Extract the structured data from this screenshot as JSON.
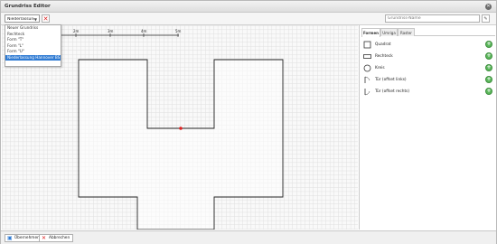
{
  "window": {
    "title": "Grundriss Editor"
  },
  "toolbar": {
    "dropdown_value": "Niederlassung Ha",
    "name_placeholder": "Grundriss-Name"
  },
  "dropdown_options": [
    {
      "label": "Neuer Grundriss",
      "selected": false
    },
    {
      "label": "Rechteck",
      "selected": false
    },
    {
      "label": "Form \"T\"",
      "selected": false
    },
    {
      "label": "Form \"L\"",
      "selected": false
    },
    {
      "label": "Form \"U\"",
      "selected": false
    },
    {
      "label": "Niederlassung Hannover BS",
      "selected": true
    }
  ],
  "scale": {
    "ticks": [
      "2m",
      "3m",
      "4m",
      "5m"
    ]
  },
  "panel": {
    "tabs": [
      {
        "label": "Formen",
        "active": true
      },
      {
        "label": "Umriga",
        "active": false
      },
      {
        "label": "Raster",
        "active": false
      }
    ],
    "shapes": [
      {
        "label": "Quadrat",
        "icon": "square-icon"
      },
      {
        "label": "Rechteck",
        "icon": "rectangle-icon"
      },
      {
        "label": "Kreis",
        "icon": "circle-icon"
      },
      {
        "label": "Tür (offset links)",
        "icon": "door-left-icon"
      },
      {
        "label": "Tür (offset rechts)",
        "icon": "door-right-icon"
      }
    ]
  },
  "footer": {
    "apply_label": "Übernehmen",
    "cancel_label": "Abbrechen"
  },
  "colors": {
    "accent": "#2f7bd3",
    "add": "#5cb85c",
    "delete": "#dd2222",
    "vertex": "#dd2222"
  }
}
